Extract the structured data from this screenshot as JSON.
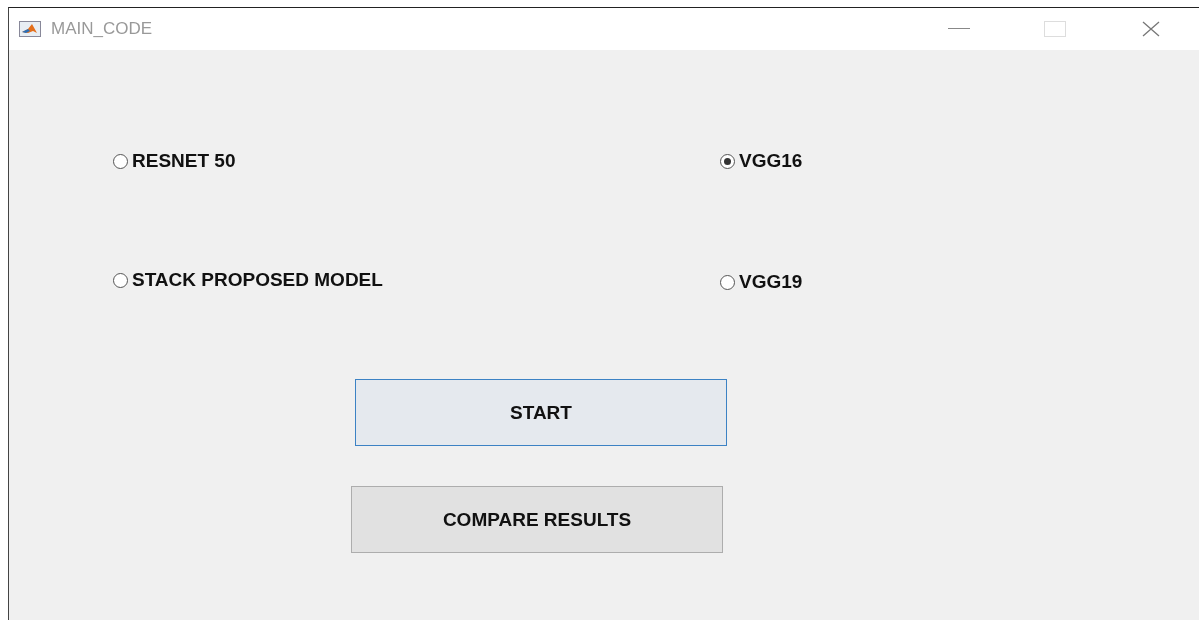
{
  "window": {
    "title": "MAIN_CODE"
  },
  "options": [
    {
      "label": "RESNET 50",
      "selected": false
    },
    {
      "label": "VGG16",
      "selected": true
    },
    {
      "label": "STACK PROPOSED MODEL",
      "selected": false
    },
    {
      "label": "VGG19",
      "selected": false
    }
  ],
  "buttons": [
    {
      "label": "START",
      "focused": true
    },
    {
      "label": "COMPARE RESULTS",
      "focused": false
    }
  ]
}
